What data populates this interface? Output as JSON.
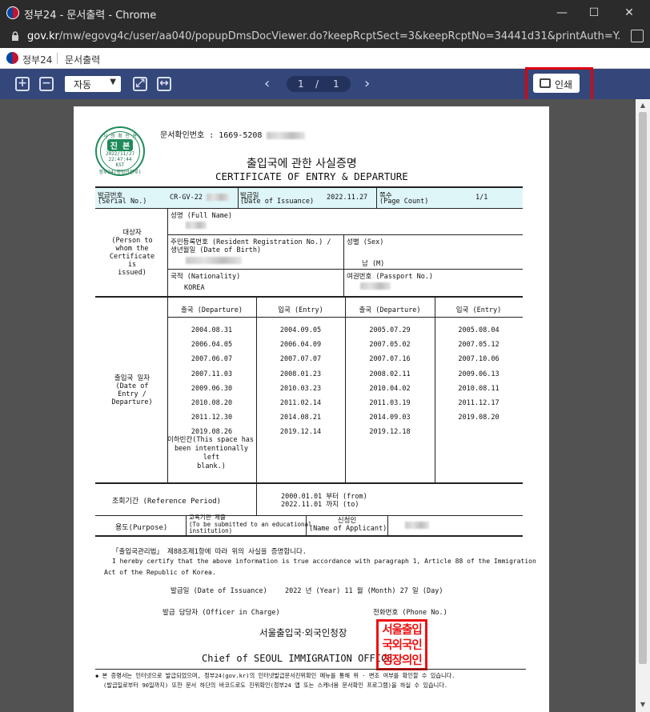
{
  "window": {
    "title": "정부24 - 문서출력 - Chrome",
    "minimize_glyph": "—",
    "maximize_glyph": "☐",
    "close_glyph": "✕"
  },
  "address": {
    "domain": "gov.kr",
    "path": "/mw/egovg4c/user/aa040/popupDmsDocViewer.do?keepRcptSect=3&keepRcptNo=34441d31&printAuth=Y..."
  },
  "appbar": {
    "brand": "정부24",
    "page_title": "문서출력"
  },
  "viewer": {
    "zoom_in_glyph": "+",
    "zoom_out_glyph": "−",
    "zoom_value": "자동",
    "fit_page_glyph": "⤢",
    "fit_width_glyph": "↔",
    "prev_glyph": "‹",
    "next_glyph": "›",
    "current_page": "1",
    "page_sep": "/",
    "total_pages": "1",
    "print_label": "인쇄"
  },
  "doc": {
    "doc_no_label": "문서확인번호 : 1669-5208",
    "seal": {
      "top": "시 청 확 인 용",
      "main": "진 본",
      "date": "2022/11/27",
      "time": "22:47:44",
      "tz": "KST",
      "bottom": "정부24(행정안전부)"
    },
    "title_ko": "출입국에 관한 사실증명",
    "title_en": "CERTIFICATE OF ENTRY & DEPARTURE",
    "serial_label": "발급번호",
    "serial_label_en": "(Serial No.)",
    "serial_value": "CR-GV-22",
    "issue_date_label": "발급일",
    "issue_date_label_en": "(Date of Issuance)",
    "issue_date_value": "2022.11.27",
    "page_count_label": "쪽수",
    "page_count_label_en": "(Page Count)",
    "page_count_value": "1/1",
    "subject_label": [
      "대상자",
      "(Person to",
      "whom the",
      "Certificate",
      "is",
      "issued)"
    ],
    "name_label": "성명 (Full Name)",
    "rrn_label_1": "주민등록번호 (Resident Registration No.) /",
    "rrn_label_2": "생년월일 (Date of Birth)",
    "sex_label": "성별 (Sex)",
    "sex_value": "남 (M)",
    "nationality_label": "국적 (Nationality)",
    "nationality_value": "KOREA",
    "passport_label": "여권번호 (Passport No.)",
    "records_label": [
      "출입국 일자",
      "(Date of",
      "Entry /",
      "Departure)"
    ],
    "col_headers": [
      "출국 (Departure)",
      "입국 (Entry)",
      "출국 (Departure)",
      "입국 (Entry)"
    ],
    "rows": [
      [
        "2004.08.31",
        "2004.09.05",
        "2005.07.29",
        "2005.08.04"
      ],
      [
        "2006.04.05",
        "2006.04.09",
        "2007.05.02",
        "2007.05.12"
      ],
      [
        "2007.06.07",
        "2007.07.07",
        "2007.07.16",
        "2007.10.06"
      ],
      [
        "2007.11.03",
        "2008.01.23",
        "2008.02.11",
        "2009.06.13"
      ],
      [
        "2009.06.30",
        "2010.03.23",
        "2010.04.02",
        "2010.08.11"
      ],
      [
        "2010.08.20",
        "2011.02.14",
        "2011.03.19",
        "2011.12.17"
      ],
      [
        "2011.12.30",
        "2014.08.21",
        "2014.09.03",
        "2019.08.20"
      ],
      [
        "2019.08.26",
        "2019.12.14",
        "2019.12.18",
        ""
      ]
    ],
    "blank_note": [
      "이하빈칸(This space has",
      "been intentionally left",
      "blank.)"
    ],
    "ref_period_label": "조회기간 (Reference Period)",
    "ref_period_from": "2000.01.01 부터 (from)",
    "ref_period_to": "2022.11.01 까지 (to)",
    "purpose_label": "용도(Purpose)",
    "purpose_value_1": "교육기관 제출",
    "purpose_value_2": "(To be submitted to an educational",
    "purpose_value_3": "institution)",
    "applicant_label": "신청인",
    "applicant_label_en": "(Name of Applicant)",
    "cert_ko": "「출입국관리법」 제88조제1항에 따라 위의 사실을 증명합니다.",
    "cert_en_1": "I hereby certify that the above information is true accordance with paragraph 1, Article 88 of the Immigration",
    "cert_en_2": "Act of the Republic of Korea.",
    "issued_on_label": "발급일 (Date of Issuance)",
    "issued_on_value": "2022 년 (Year)   11 월 (Month)   27 일 (Day)",
    "officer_label": "발급 담당자 (Officer in Charge)",
    "phone_label": "전화번호 (Phone No.)",
    "office_ko": "서울출입국·외국인청장",
    "office_en": "Chief of SEOUL IMMIGRATION OFFICE",
    "stamp_lines": [
      "서울출입",
      "국외국인",
      "청장의인"
    ],
    "footnote_1": "◆ 본 증명서는 인터넷으로 발급되었으며, 정부24(gov.kr)의 인터넷발급문서진위확인 메뉴를 통해 위 · 변조 여부를 확인할 수 있습니다.",
    "footnote_2": "(발급일로부터 90일까지) 또한 문서 하단의 바코드로도 진위확인(정부24 앱 또는 스캐너용 문서확인 프로그램)을 하실 수 있습니다."
  }
}
